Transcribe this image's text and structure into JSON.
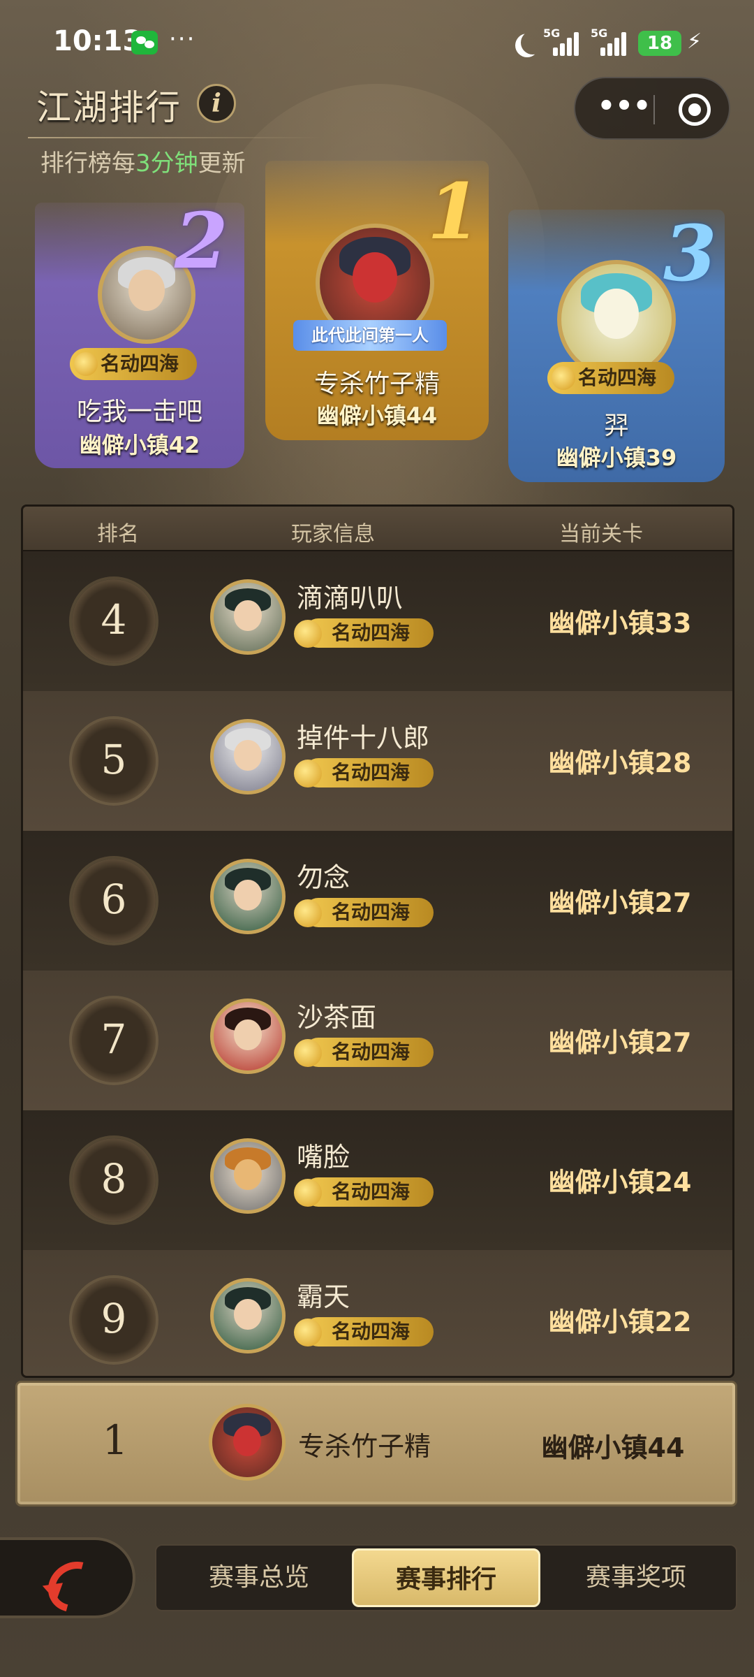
{
  "status_bar": {
    "time": "10:13",
    "dots": "···",
    "net1": "5G",
    "net2": "5G",
    "battery": "18",
    "bolt": "⚡"
  },
  "header": {
    "title": "江湖排行",
    "info": "i",
    "subtitle_prefix": "排行榜每",
    "subtitle_highlight": "3分钟",
    "subtitle_suffix": "更新",
    "more": "•••"
  },
  "podium": [
    {
      "rank": "1",
      "name": "专杀竹子精",
      "level": "幽僻小镇44",
      "badge": "此代此间第一人"
    },
    {
      "rank": "2",
      "name": "吃我一击吧",
      "level": "幽僻小镇42",
      "badge": "名动四海"
    },
    {
      "rank": "3",
      "name": "羿",
      "level": "幽僻小镇39",
      "badge": "名动四海"
    }
  ],
  "table": {
    "headers": {
      "rank": "排名",
      "player": "玩家信息",
      "level": "当前关卡"
    },
    "rows": [
      {
        "rank": "4",
        "name": "滴滴叭叭",
        "badge": "名动四海",
        "level": "幽僻小镇33"
      },
      {
        "rank": "5",
        "name": "掉件十八郎",
        "badge": "名动四海",
        "level": "幽僻小镇28"
      },
      {
        "rank": "6",
        "name": "勿念",
        "badge": "名动四海",
        "level": "幽僻小镇27"
      },
      {
        "rank": "7",
        "name": "沙茶面",
        "badge": "名动四海",
        "level": "幽僻小镇27"
      },
      {
        "rank": "8",
        "name": "嘴脸",
        "badge": "名动四海",
        "level": "幽僻小镇24"
      },
      {
        "rank": "9",
        "name": "霸天",
        "badge": "名动四海",
        "level": "幽僻小镇22"
      }
    ]
  },
  "my_rank": {
    "rank": "1",
    "name": "专杀竹子精",
    "level": "幽僻小镇44"
  },
  "tabs": [
    {
      "label": "赛事总览",
      "active": false
    },
    {
      "label": "赛事排行",
      "active": true
    },
    {
      "label": "赛事奖项",
      "active": false
    }
  ]
}
